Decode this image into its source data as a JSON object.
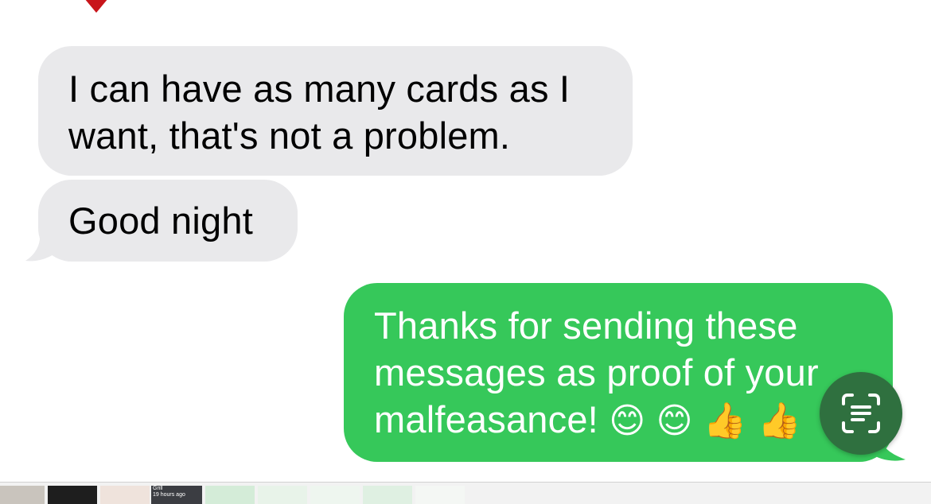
{
  "conversation": {
    "messages": [
      {
        "direction": "incoming",
        "lines": [
          "I can have as many cards as I",
          "want, that's not a problem."
        ]
      },
      {
        "direction": "incoming",
        "lines": [
          "Good night"
        ]
      },
      {
        "direction": "outgoing",
        "lines": [
          "Thanks for sending these",
          "messages as proof of your"
        ],
        "last_line_text": "malfeasance!",
        "emojis": [
          "😊",
          "😊",
          "👍",
          "👍"
        ]
      }
    ]
  },
  "colors": {
    "incoming_bubble": "#e9e9eb",
    "outgoing_bubble": "#36c85a",
    "live_text_button": "#2f703f",
    "tapback_heart": "#d11a1a"
  },
  "icons": {
    "tapback": "heart-icon",
    "live_text": "live-text-icon"
  },
  "filmstrip": {
    "thumbnails": [
      {
        "caption": ""
      },
      {
        "caption": ""
      },
      {
        "caption": ""
      },
      {
        "caption": "Grill",
        "subcaption": "19 hours ago"
      },
      {
        "caption": ""
      },
      {
        "caption": ""
      },
      {
        "caption": ""
      },
      {
        "caption": ""
      }
    ]
  }
}
